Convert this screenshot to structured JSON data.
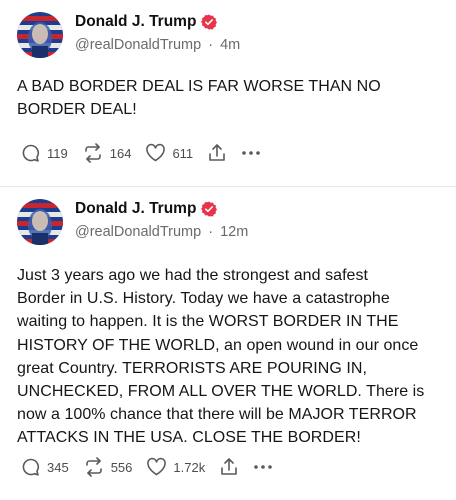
{
  "posts": [
    {
      "author": {
        "name": "Donald J. Trump",
        "handle": "@realDonaldTrump",
        "time": "4m"
      },
      "text": "A BAD BORDER DEAL IS FAR WORSE THAN NO\nBORDER DEAL!",
      "stats": {
        "replies": "119",
        "reposts": "164",
        "likes": "611"
      }
    },
    {
      "author": {
        "name": "Donald J. Trump",
        "handle": "@realDonaldTrump",
        "time": "12m"
      },
      "text": "Just 3 years ago we had the strongest and safest\nBorder in U.S. History. Today we have a catastrophe\nwaiting to happen. It is the WORST BORDER IN THE\nHISTORY OF THE WORLD, an open wound in our once\ngreat Country. TERRORISTS ARE POURING IN,\nUNCHECKED, FROM ALL OVER THE WORLD. There is\nnow a 100% chance that there will be MAJOR TERROR\nATTACKS IN THE USA. CLOSE THE BORDER!",
      "stats": {
        "replies": "345",
        "reposts": "556",
        "likes": "1.72k"
      }
    }
  ],
  "separator": "·",
  "icons": {
    "verified": "verified-badge-icon",
    "reply": "reply-icon",
    "repost": "repost-icon",
    "like": "heart-icon",
    "share": "share-icon",
    "more": "more-icon"
  },
  "colors": {
    "verified": "#e8334a",
    "muted": "#6b6b6b",
    "icon": "#5a5a5a"
  }
}
